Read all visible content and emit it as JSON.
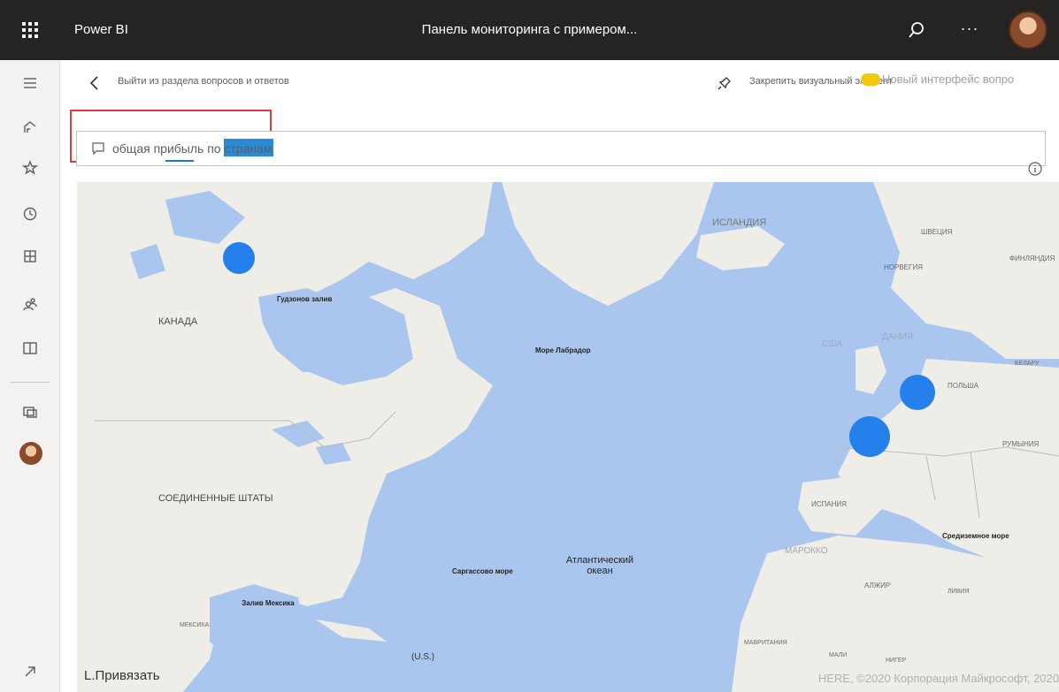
{
  "app": {
    "brand": "Power BI",
    "document_title": "Панель мониторинга с примером...",
    "colors": {
      "topbar": "#252423",
      "accent": "#2680eb",
      "highlight": "#e03a3a"
    }
  },
  "topbar_icons": [
    "waffle-icon",
    "search-icon",
    "more-icon",
    "avatar"
  ],
  "leftnav": {
    "items": [
      "menu-icon",
      "home-icon",
      "favorites-icon",
      "recent-icon",
      "apps-icon",
      "shared-icon",
      "learn-icon",
      "workspaces-icon",
      "avatar",
      "popout-icon"
    ]
  },
  "toolbar": {
    "exit_label": "Выйти из раздела вопросов и ответов",
    "pin_label": "Закрепить визуальный элемент",
    "new_ui_label": "Новый интерфейс вопро"
  },
  "qa": {
    "query": "общая прибыль по странам"
  },
  "map": {
    "labels": {
      "canada": "КАНАДА",
      "hudson_bay": "Гудзонов залив",
      "usa": "СОЕДИНЕННЫЕ ШТАТЫ",
      "iceland": "ИСЛАНДИЯ",
      "norway": "НОРВЕГИЯ",
      "sweden": "ШВЕЦИЯ",
      "finland": "ФИНЛЯНДИЯ",
      "labrador": "Море Лабрадор",
      "atlantic": "Атлантический океан",
      "sargasso": "Саргассово море",
      "gulf_mexico": "Залив Мексика",
      "mexico": "МЕКСИКА",
      "spain": "ИСПАНИЯ",
      "morocco": "МАРОККО",
      "algeria": "АЛЖИР",
      "poland": "ПОЛЬША",
      "romania": "РУМЫНИЯ",
      "med_sea": "Средиземное море",
      "mauritania": "МАВРИТАНИЯ",
      "mali": "МАЛИ",
      "niger": "НИГЕР",
      "libya": "ЛИВИЯ",
      "belarus": "БЕЛАРУ",
      "uk": "США",
      "denmark": "ДАНИЯ",
      "us_short": "(U.S.)"
    },
    "snap_label": "L.Привязать",
    "copyright": "HERE, ©2020 Корпорация Майкрософт, 2020"
  }
}
